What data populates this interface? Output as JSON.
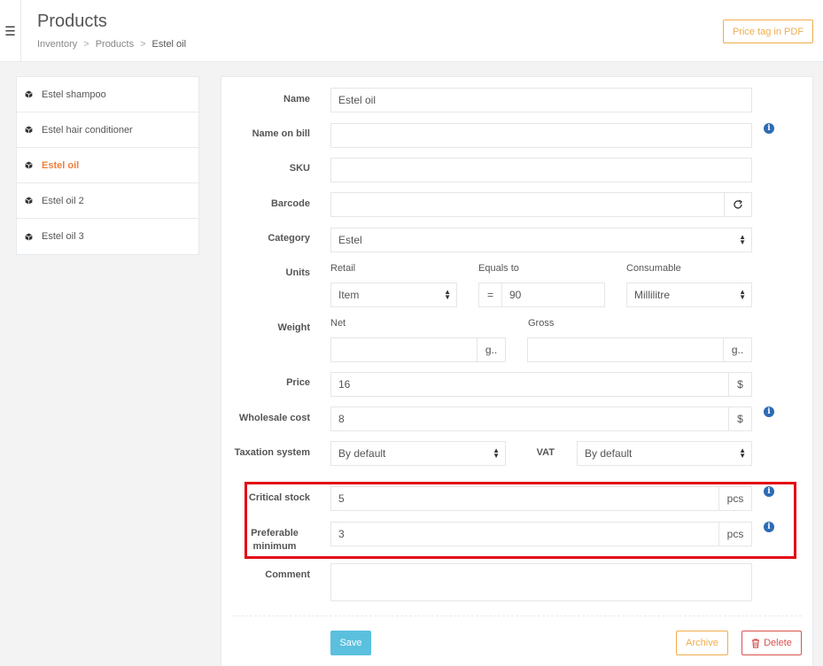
{
  "header": {
    "menu_icon": "hamburger-icon",
    "title": "Products",
    "breadcrumb": [
      "Inventory",
      "Products",
      "Estel oil"
    ],
    "breadcrumb_sep": ">",
    "pdf_button": "Price tag in PDF"
  },
  "sidebar": {
    "items": [
      {
        "label": "Estel shampoo",
        "icon": "cube-icon"
      },
      {
        "label": "Estel hair conditioner",
        "icon": "cube-icon"
      },
      {
        "label": "Estel oil",
        "icon": "cube-icon",
        "active": true
      },
      {
        "label": "Estel oil 2",
        "icon": "cube-icon"
      },
      {
        "label": "Estel oil 3",
        "icon": "cube-icon"
      }
    ]
  },
  "form": {
    "name": {
      "label": "Name",
      "value": "Estel oil"
    },
    "name_on_bill": {
      "label": "Name on bill",
      "value": ""
    },
    "sku": {
      "label": "SKU",
      "value": ""
    },
    "barcode": {
      "label": "Barcode",
      "value": ""
    },
    "category": {
      "label": "Category",
      "value": "Estel"
    },
    "units": {
      "label": "Units",
      "retail_label": "Retail",
      "retail_value": "Item",
      "equals_label": "Equals to",
      "equals_sign": "=",
      "equals_value": "90",
      "consumable_label": "Consumable",
      "consumable_value": "Millilitre"
    },
    "weight": {
      "label": "Weight",
      "net_label": "Net",
      "net_value": "",
      "net_unit": "g..",
      "gross_label": "Gross",
      "gross_value": "",
      "gross_unit": "g.."
    },
    "price": {
      "label": "Price",
      "value": "16",
      "currency": "$"
    },
    "wholesale_cost": {
      "label": "Wholesale cost",
      "value": "8",
      "currency": "$"
    },
    "taxation": {
      "label": "Taxation system",
      "value": "By default"
    },
    "vat": {
      "label": "VAT",
      "value": "By default"
    },
    "critical_stock": {
      "label": "Critical stock",
      "value": "5",
      "unit": "pcs"
    },
    "preferable_minimum": {
      "label_line1": "Preferable",
      "label_line2": "minimum",
      "value": "3",
      "unit": "pcs"
    },
    "comment": {
      "label": "Comment",
      "value": ""
    }
  },
  "actions": {
    "save": "Save",
    "archive": "Archive",
    "delete": "Delete"
  },
  "colors": {
    "accent_orange": "#f07d3a",
    "warning": "#f0ad4e",
    "danger": "#d9534f",
    "info_blue": "#2c6bb5",
    "save_blue": "#5bc0de",
    "highlight_red": "#e30613"
  }
}
